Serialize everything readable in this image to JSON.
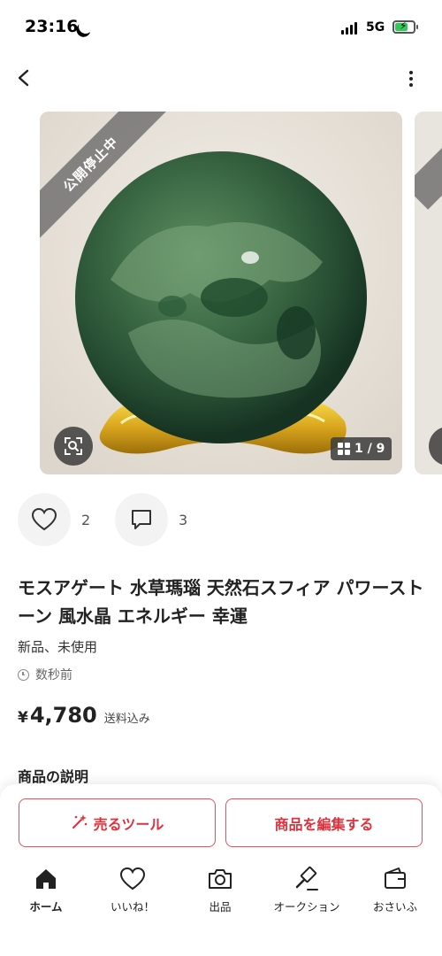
{
  "status_bar": {
    "time": "23:16",
    "network": "5G",
    "battery_level": 0.7,
    "battery_color": "#34c759"
  },
  "nav": {
    "back_icon": "chevron-left-icon",
    "more_icon": "more-vertical-icon"
  },
  "photo": {
    "ribbon_text": "公開停止中",
    "page_counter": "1 / 9",
    "scan_icon": "image-search-icon"
  },
  "actions": {
    "like_count": "2",
    "comment_count": "3"
  },
  "item": {
    "title": "モスアゲート 水草瑪瑙 天然石スフィア パワーストーン 風水晶 エネルギー 幸運",
    "condition": "新品、未使用",
    "posted": "数秒前",
    "currency": "¥",
    "price": "4,780",
    "shipping_note": "送料込み",
    "description_heading": "商品の説明"
  },
  "buttons": {
    "sell_tool": "売るツール",
    "edit_item": "商品を編集する"
  },
  "tabs": [
    {
      "label": "ホーム",
      "icon": "home-icon"
    },
    {
      "label": "いいね！",
      "icon": "heart-icon"
    },
    {
      "label": "出品",
      "icon": "camera-icon"
    },
    {
      "label": "オークション",
      "icon": "auction-hammer-icon"
    },
    {
      "label": "おさいふ",
      "icon": "wallet-icon"
    }
  ],
  "colors": {
    "accent": "#e0303c",
    "text": "#222222"
  }
}
